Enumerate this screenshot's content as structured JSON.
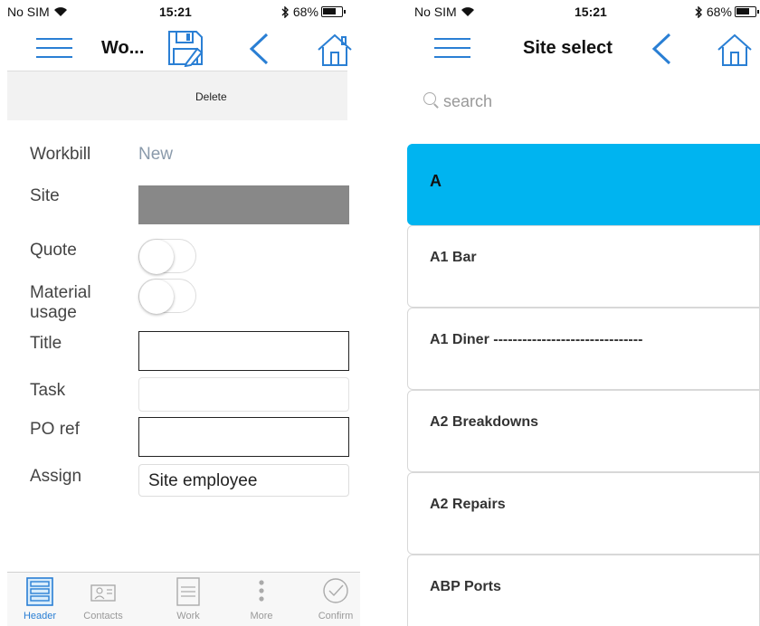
{
  "left": {
    "status": {
      "carrier": "No SIM",
      "time": "15:21",
      "battery": "68%"
    },
    "nav_title": "Wo...",
    "subbar": {
      "delete_label": "Delete"
    },
    "form": {
      "workbill_label": "Workbill",
      "workbill_value": "New",
      "site_label": "Site",
      "quote_label": "Quote",
      "material_label_1": "Material",
      "material_label_2": "usage",
      "title_label": "Title",
      "task_label": "Task",
      "po_label": "PO ref",
      "assign_label": "Assign",
      "assign_value": "Site employee"
    },
    "tabs": [
      {
        "label": "Header",
        "icon": "header-icon",
        "active": true
      },
      {
        "label": "Contacts",
        "icon": "contacts-icon"
      },
      {
        "label": "Work",
        "icon": "work-icon"
      },
      {
        "label": "More",
        "icon": "more-icon"
      },
      {
        "label": "Confirm",
        "icon": "confirm-icon"
      }
    ]
  },
  "right": {
    "status": {
      "carrier": "No SIM",
      "time": "15:21",
      "battery": "68%"
    },
    "nav_title": "Site select",
    "search": {
      "placeholder": "search"
    },
    "list": [
      {
        "label": "A",
        "header": true
      },
      {
        "label": "A1 Bar"
      },
      {
        "label": "A1 Diner -------------------------------"
      },
      {
        "label": "A2 Breakdowns"
      },
      {
        "label": "A2 Repairs"
      },
      {
        "label": "ABP Ports"
      }
    ]
  },
  "colors": {
    "accent": "#2a7fd4",
    "section_header": "#00b4f0",
    "site_placeholder": "#888888"
  }
}
